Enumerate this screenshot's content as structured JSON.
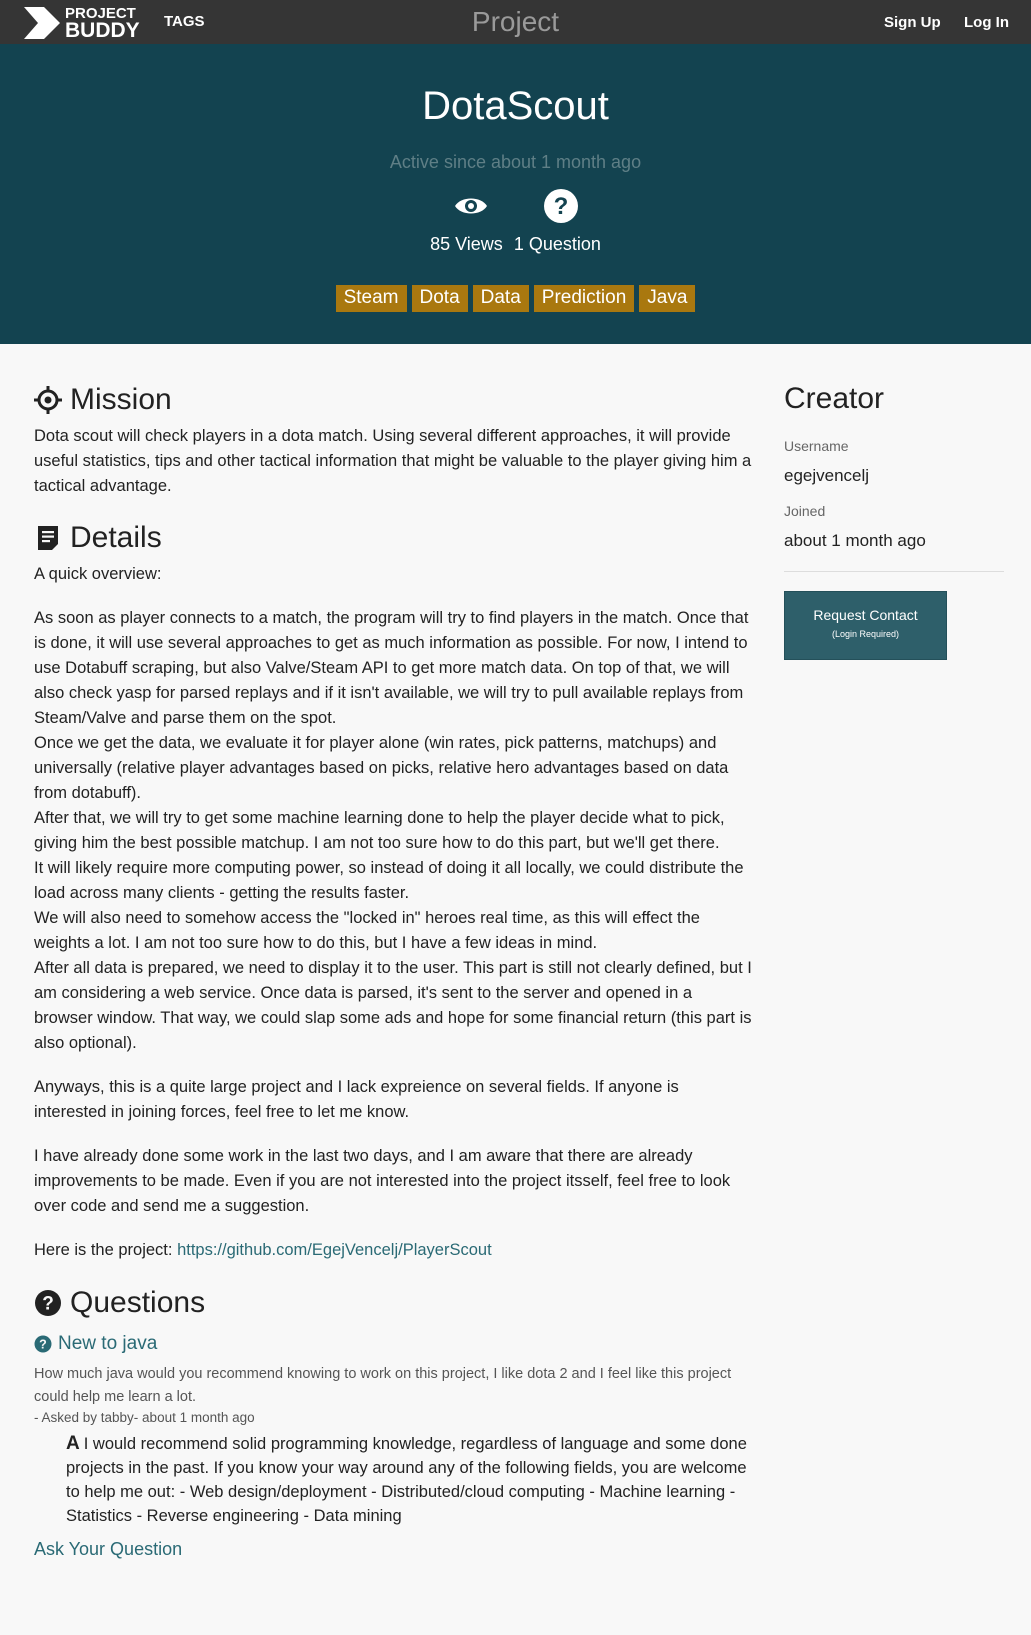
{
  "nav": {
    "logo_line1": "PROJECT",
    "logo_line2": "BUDDY",
    "tags": "TAGS",
    "title": "Project",
    "sign_up": "Sign Up",
    "log_in": "Log In"
  },
  "hero": {
    "name": "DotaScout",
    "active_since": "Active since about 1 month ago",
    "views": "85 Views",
    "questions": "1 Question",
    "tags": [
      "Steam",
      "Dota",
      "Data",
      "Prediction",
      "Java"
    ]
  },
  "mission": {
    "heading": "Mission",
    "text": "Dota scout will check players in a dota match. Using several different approaches, it will provide useful statistics, tips and other tactical information that might be valuable to the player giving him a tactical advantage."
  },
  "details": {
    "heading": "Details",
    "intro": "A quick overview:",
    "p1_lines": [
      "As soon as player connects to a match, the program will try to find players in the match. Once that is done, it will use several approaches to get as much information as possible. For now, I intend to use Dotabuff scraping, but also Valve/Steam API to get more match data. On top of that, we will also check yasp for parsed replays and if it isn't available, we will try to pull available replays from Steam/Valve and parse them on the spot.",
      "Once we get the data, we evaluate it for player alone (win rates, pick patterns, matchups) and universally (relative player advantages based on picks, relative hero advantages based on data from dotabuff).",
      "After that, we will try to get some machine learning done to help the player decide what to pick, giving him the best possible matchup. I am not too sure how to do this part, but we'll get there.",
      "It will likely require more computing power, so instead of doing it all locally, we could distribute the load across many clients - getting the results faster.",
      "We will also need to somehow access the \"locked in\" heroes real time, as this will effect the weights a lot. I am not too sure how to do this, but I have a few ideas in mind.",
      "After all data is prepared, we need to display it to the user. This part is still not clearly defined, but I am considering a web service. Once data is parsed, it's sent to the server and opened in a browser window. That way, we could slap some ads and hope for some financial return (this part is also optional)."
    ],
    "p2": "Anyways, this is a quite large project and I lack expreience on several fields. If anyone is interested in joining forces, feel free to let me know.",
    "p3": "I have already done some work in the last two days, and I am aware that there are already improvements to be made. Even if you are not interested into the project itsself, feel free to look over code and send me a suggestion.",
    "project_prefix": "Here is the project: ",
    "project_link": "https://github.com/EgejVencelj/PlayerScout"
  },
  "questions": {
    "heading": "Questions",
    "items": [
      {
        "title": "New to java",
        "body": "How much java would you recommend knowing to work on this project, I like dota 2 and I feel like this project could help me learn a lot.",
        "meta": "- Asked by tabby- about 1 month ago",
        "answer_mark": "A",
        "answer": "I would recommend solid programming knowledge, regardless of language and some done projects in the past. If you know your way around any of the following fields, you are welcome to help me out: - Web design/deployment - Distributed/cloud computing - Machine learning - Statistics - Reverse engineering - Data mining"
      }
    ],
    "ask": "Ask Your Question"
  },
  "creator": {
    "heading": "Creator",
    "username_label": "Username",
    "username": "egejvencelj",
    "joined_label": "Joined",
    "joined": "about 1 month ago",
    "request_contact": "Request Contact",
    "login_required": "(Login Required)"
  },
  "colors": {
    "navbar": "#353535",
    "hero": "#134350",
    "tag": "#a9780f",
    "link": "#2a6a75",
    "button": "#2e5f6a"
  },
  "icons": {
    "logo": "chevron-logo-icon",
    "views": "eye-icon",
    "questions": "question-circle-icon",
    "mission": "crosshair-icon",
    "details": "document-icon"
  }
}
